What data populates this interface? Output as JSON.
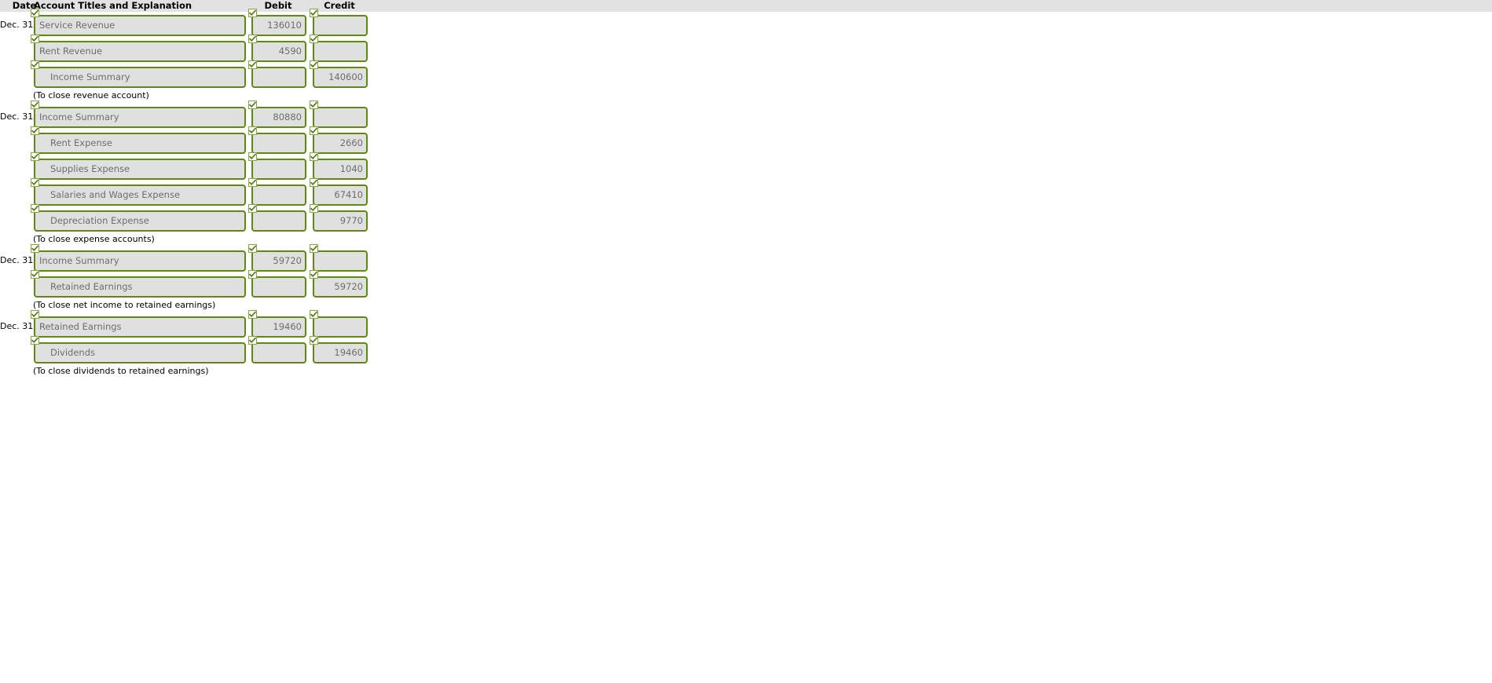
{
  "table": {
    "columns": {
      "date": "Date",
      "account": "Account Titles and Explanation",
      "debit": "Debit",
      "credit": "Credit"
    },
    "colors": {
      "field_border": "#5f8a10",
      "field_background": "#e0e0e0",
      "header_background": "#e2e2e2",
      "field_text": "#6d6d6d",
      "check_mark": "#4c7a0b"
    },
    "check_icon_name": "check-icon"
  },
  "entries": [
    {
      "date": "Dec. 31",
      "lines": [
        {
          "account": "Service Revenue",
          "indent": false,
          "debit": "136010",
          "credit": ""
        },
        {
          "account": "Rent Revenue",
          "indent": false,
          "debit": "4590",
          "credit": ""
        },
        {
          "account": "Income Summary",
          "indent": true,
          "debit": "",
          "credit": "140600"
        }
      ],
      "explanation": "(To close revenue account)"
    },
    {
      "date": "Dec. 31",
      "lines": [
        {
          "account": "Income Summary",
          "indent": false,
          "debit": "80880",
          "credit": ""
        },
        {
          "account": "Rent Expense",
          "indent": true,
          "debit": "",
          "credit": "2660"
        },
        {
          "account": "Supplies Expense",
          "indent": true,
          "debit": "",
          "credit": "1040"
        },
        {
          "account": "Salaries and Wages Expense",
          "indent": true,
          "debit": "",
          "credit": "67410"
        },
        {
          "account": "Depreciation Expense",
          "indent": true,
          "debit": "",
          "credit": "9770"
        }
      ],
      "explanation": "(To close expense accounts)"
    },
    {
      "date": "Dec. 31",
      "lines": [
        {
          "account": "Income Summary",
          "indent": false,
          "debit": "59720",
          "credit": ""
        },
        {
          "account": "Retained Earnings",
          "indent": true,
          "debit": "",
          "credit": "59720"
        }
      ],
      "explanation": "(To close net income to retained earnings)"
    },
    {
      "date": "Dec. 31",
      "lines": [
        {
          "account": "Retained Earnings",
          "indent": false,
          "debit": "19460",
          "credit": ""
        },
        {
          "account": "Dividends",
          "indent": true,
          "debit": "",
          "credit": "19460"
        }
      ],
      "explanation": "(To close dividends to retained earnings)"
    }
  ]
}
